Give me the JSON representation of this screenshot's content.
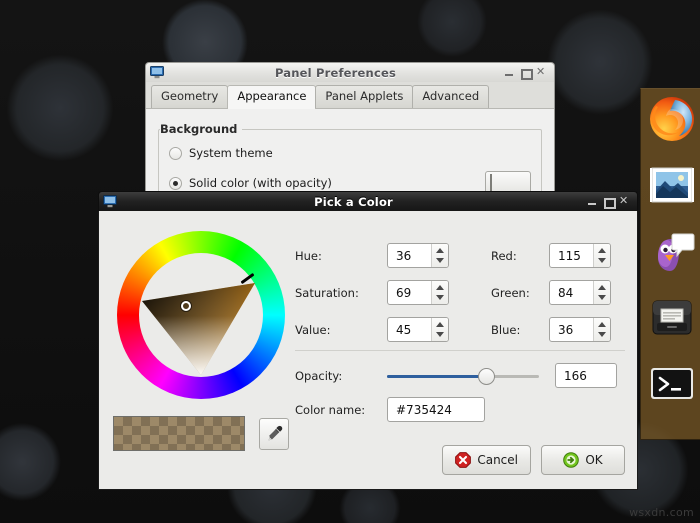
{
  "desktop": {
    "watermark": "wsxdn.com"
  },
  "dock": {
    "items": [
      {
        "name": "firefox",
        "label": "Firefox"
      },
      {
        "name": "image-viewer",
        "label": "Image Viewer"
      },
      {
        "name": "pidgin",
        "label": "Pidgin"
      },
      {
        "name": "file-manager",
        "label": "File Manager"
      },
      {
        "name": "terminal",
        "label": "Terminal"
      }
    ]
  },
  "panel_preferences": {
    "title": "Panel Preferences",
    "window_buttons": {
      "minimize": "_",
      "maximize": "□",
      "close": "✕"
    },
    "tabs": [
      {
        "label": "Geometry",
        "active": false
      },
      {
        "label": "Appearance",
        "active": true
      },
      {
        "label": "Panel Applets",
        "active": false
      },
      {
        "label": "Advanced",
        "active": false
      }
    ],
    "background_group": {
      "title": "Background",
      "options": [
        {
          "label": "System theme",
          "selected": false
        },
        {
          "label": "Solid color (with opacity)",
          "selected": true
        }
      ],
      "swatch_color": "#735424"
    }
  },
  "pick_a_color": {
    "title": "Pick a Color",
    "window_buttons": {
      "minimize": "_",
      "maximize": "□",
      "close": "✕"
    },
    "hsv": [
      {
        "label": "Hue:",
        "value": "36"
      },
      {
        "label": "Saturation:",
        "value": "69"
      },
      {
        "label": "Value:",
        "value": "45"
      }
    ],
    "rgb": [
      {
        "label": "Red:",
        "value": "115"
      },
      {
        "label": "Green:",
        "value": "84"
      },
      {
        "label": "Blue:",
        "value": "36"
      }
    ],
    "opacity": {
      "label": "Opacity:",
      "value": "166",
      "percent": 65
    },
    "color_name": {
      "label": "Color name:",
      "value": "#735424"
    },
    "preview_color": "#735424",
    "eyedropper": "eyedropper-icon",
    "buttons": {
      "cancel": "Cancel",
      "ok": "OK"
    }
  }
}
